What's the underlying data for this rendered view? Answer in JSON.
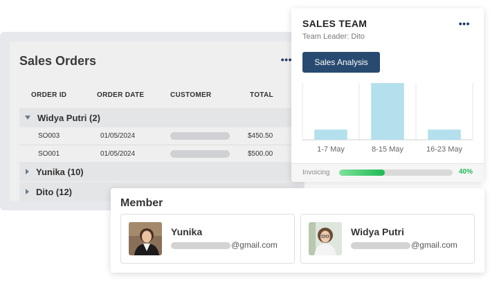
{
  "sales_orders": {
    "title": "Sales Orders",
    "more_icon": "more-horizontal-icon",
    "columns": [
      "ORDER ID",
      "ORDER DATE",
      "CUSTOMER",
      "TOTAL"
    ],
    "groups": [
      {
        "label": "Widya Putri (2)",
        "expanded": true,
        "rows": [
          {
            "order_id": "SO003",
            "order_date": "01/05/2024",
            "total": "$450.50"
          },
          {
            "order_id": "SO001",
            "order_date": "01/05/2024",
            "total": "$500.00"
          }
        ]
      },
      {
        "label": "Yunika (10)",
        "expanded": false
      },
      {
        "label": "Dito (12)",
        "expanded": false
      }
    ]
  },
  "sales_team": {
    "title": "SALES TEAM",
    "subtitle": "Team Leader: Dito",
    "more_icon": "more-horizontal-icon",
    "button_label": "Sales Analysis",
    "invoicing": {
      "label": "Invoicing",
      "progress": 0.4,
      "percent_text": "40%"
    }
  },
  "chart_data": {
    "type": "bar",
    "categories": [
      "1-7 May",
      "8-15 May",
      "16-23 May"
    ],
    "values": [
      18,
      100,
      18
    ],
    "ylim": [
      0,
      100
    ],
    "grid": true,
    "bar_color": "#b3e0ec"
  },
  "members": {
    "title": "Member",
    "items": [
      {
        "name": "Yunika",
        "email_suffix": "@gmail.com"
      },
      {
        "name": "Widya Putri",
        "email_suffix": "@gmail.com"
      }
    ]
  },
  "colors": {
    "accent": "#284a70",
    "progress": "#1db954"
  }
}
